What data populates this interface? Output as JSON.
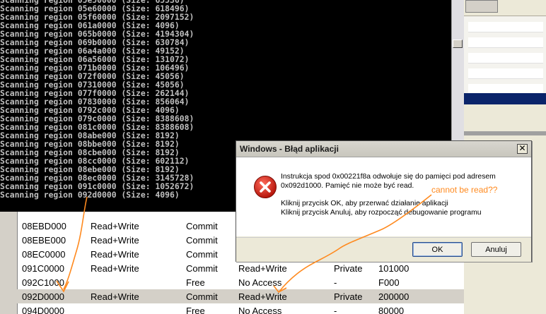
{
  "console": {
    "lines": [
      "Scanning region 05e50000 (Size: 65536)",
      "Scanning region 05e60000 (Size: 618496)",
      "Scanning region 05f60000 (Size: 2097152)",
      "Scanning region 061a0000 (Size: 4096)",
      "Scanning region 065b0000 (Size: 4194304)",
      "Scanning region 069b0000 (Size: 630784)",
      "Scanning region 06a4a000 (Size: 49152)",
      "Scanning region 06a56000 (Size: 131072)",
      "Scanning region 071b0000 (Size: 106496)",
      "Scanning region 072f0000 (Size: 45056)",
      "Scanning region 07310000 (Size: 45056)",
      "Scanning region 077f0000 (Size: 262144)",
      "Scanning region 07830000 (Size: 856064)",
      "Scanning region 0792c000 (Size: 4096)",
      "Scanning region 079c0000 (Size: 8388608)",
      "Scanning region 081c0000 (Size: 8388608)",
      "Scanning region 08abe000 (Size: 8192)",
      "Scanning region 08bbe000 (Size: 8192)",
      "Scanning region 08cbe000 (Size: 8192)",
      "Scanning region 08cc0000 (Size: 602112)",
      "Scanning region 08ebe000 (Size: 8192)",
      "Scanning region 08ec0000 (Size: 3145728)",
      "Scanning region 091c0000 (Size: 1052672)",
      "Scanning region 092d0000 (Size: 4096)"
    ]
  },
  "memory_table": {
    "rows": [
      {
        "address": "08EBD000",
        "access": "Read+Write",
        "state": "Commit",
        "protect": "",
        "type": "",
        "size": ""
      },
      {
        "address": "08EBE000",
        "access": "Read+Write",
        "state": "Commit",
        "protect": "",
        "type": "",
        "size": ""
      },
      {
        "address": "08EC0000",
        "access": "Read+Write",
        "state": "Commit",
        "protect": "",
        "type": "",
        "size": ""
      },
      {
        "address": "091C0000",
        "access": "Read+Write",
        "state": "Commit",
        "protect": "Read+Write",
        "type": "Private",
        "size": "101000"
      },
      {
        "address": "092C1000",
        "access": "",
        "state": "Free",
        "protect": "No Access",
        "type": "-",
        "size": "F000"
      },
      {
        "address": "092D0000",
        "access": "Read+Write",
        "state": "Commit",
        "protect": "Read+Write",
        "type": "Private",
        "size": "200000",
        "selected": true
      },
      {
        "address": "094D0000",
        "access": "",
        "state": "Free",
        "protect": "No Access",
        "type": "-",
        "size": "80000"
      }
    ]
  },
  "dialog": {
    "title": "Windows - Błąd aplikacji",
    "close": "✕",
    "message_line1": "Instrukcja spod 0x00221f8a odwołuje się do pamięci pod adresem",
    "message_line2": "0x092d1000. Pamięć nie może być read.",
    "message_line3": "Kliknij przycisk OK, aby przerwać działanie aplikacji",
    "message_line4": "Kliknij przycisk Anuluj, aby rozpocząć debugowanie programu",
    "ok_label": "OK",
    "cancel_label": "Anuluj",
    "icon": "error-icon"
  },
  "annotation": {
    "text": "cannot be read??",
    "color": "#ff8a1f"
  }
}
